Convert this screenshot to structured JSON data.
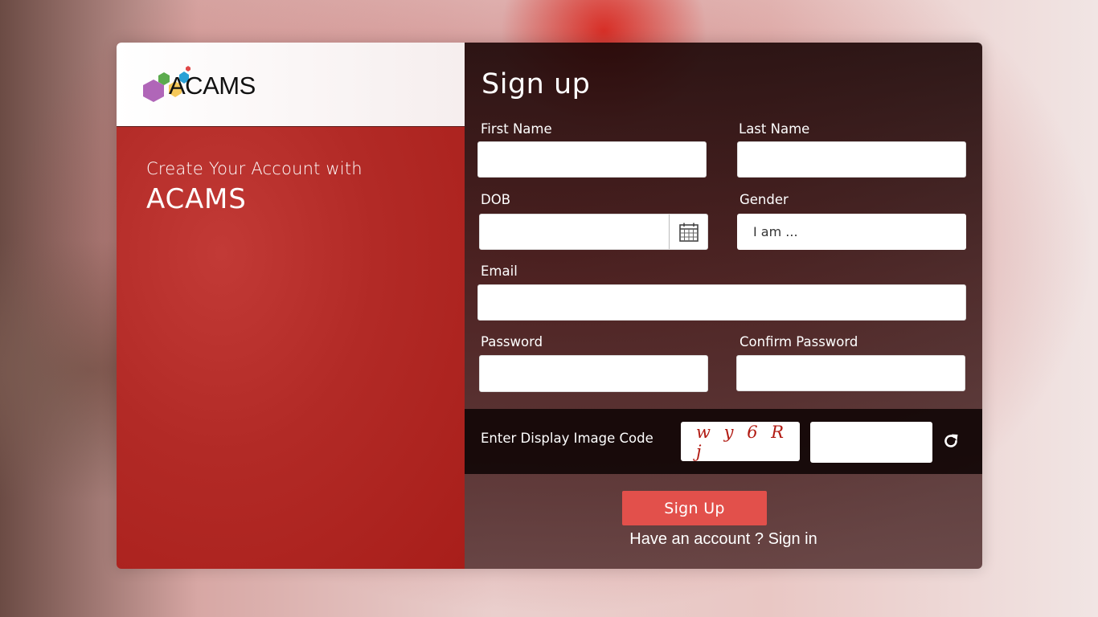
{
  "brand": {
    "logo_text": "ACAMS",
    "tagline_line1": "Create Your Account with",
    "tagline_line2": "ACAMS",
    "colors": {
      "primary": "#b22a26",
      "button": "#e2504b",
      "dark_panel": "#1e0808"
    }
  },
  "form": {
    "title": "Sign up",
    "first_name": {
      "label": "First Name",
      "value": ""
    },
    "last_name": {
      "label": "Last Name",
      "value": ""
    },
    "dob": {
      "label": "DOB",
      "value": "",
      "icon": "calendar-icon"
    },
    "gender": {
      "label": "Gender",
      "selected": "I am ..."
    },
    "email": {
      "label": "Email",
      "value": ""
    },
    "password": {
      "label": "Password",
      "value": ""
    },
    "confirm_password": {
      "label": "Confirm Password",
      "value": ""
    },
    "captcha": {
      "label": "Enter Display Image Code",
      "code": "w y 6 R j",
      "value": "",
      "refresh_icon": "refresh-icon"
    },
    "submit_label": "Sign Up",
    "signin_prompt": "Have an account ? ",
    "signin_link": "Sign in"
  }
}
